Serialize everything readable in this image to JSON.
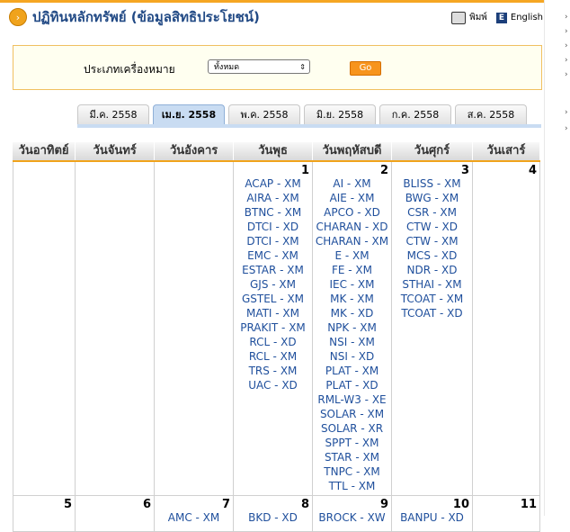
{
  "page": {
    "title": "ปฏิทินหลักทรัพย์ (ข้อมูลสิทธิประโยชน์)",
    "print_label": "พิมพ์",
    "english_label": "English"
  },
  "filter": {
    "label": "ประเภทเครื่องหมาย",
    "selected": "ทั้งหมด",
    "go_label": "Go"
  },
  "tabs": [
    "มี.ค. 2558",
    "เม.ย. 2558",
    "พ.ค. 2558",
    "มิ.ย. 2558",
    "ก.ค. 2558",
    "ส.ค. 2558"
  ],
  "active_tab": 1,
  "weekdays": [
    "วันอาทิตย์",
    "วันจันทร์",
    "วันอังคาร",
    "วันพุธ",
    "วันพฤหัสบดี",
    "วันศุกร์",
    "วันเสาร์"
  ],
  "week1": [
    {
      "day": "",
      "items": []
    },
    {
      "day": "",
      "items": []
    },
    {
      "day": "",
      "items": []
    },
    {
      "day": "1",
      "items": [
        "ACAP - XM",
        "AIRA - XM",
        "BTNC - XM",
        "DTCI - XD",
        "DTCI - XM",
        "EMC - XM",
        "ESTAR - XM",
        "GJS - XM",
        "GSTEL - XM",
        "MATI - XM",
        "PRAKIT - XM",
        "RCL - XD",
        "RCL - XM",
        "TRS - XM",
        "UAC - XD"
      ]
    },
    {
      "day": "2",
      "items": [
        "AI - XM",
        "AIE - XM",
        "APCO - XD",
        "CHARAN - XD",
        "CHARAN - XM",
        "E - XM",
        "FE - XM",
        "IEC - XM",
        "MK - XM",
        "MK - XD",
        "NPK - XM",
        "NSI - XM",
        "NSI - XD",
        "PLAT - XM",
        "PLAT - XD",
        "RML-W3 - XE",
        "SOLAR - XM",
        "SOLAR - XR",
        "SPPT - XM",
        "STAR - XM",
        "TNPC - XM",
        "TTL - XM"
      ]
    },
    {
      "day": "3",
      "items": [
        "BLISS - XM",
        "BWG - XM",
        "CSR - XM",
        "CTW - XD",
        "CTW - XM",
        "MCS - XD",
        "NDR - XD",
        "STHAI - XM",
        "TCOAT - XM",
        "TCOAT - XD"
      ]
    },
    {
      "day": "4",
      "items": []
    }
  ],
  "week2": [
    {
      "day": "5",
      "items": []
    },
    {
      "day": "6",
      "items": []
    },
    {
      "day": "7",
      "items": [
        "AMC - XM"
      ]
    },
    {
      "day": "8",
      "items": [
        "BKD - XD"
      ]
    },
    {
      "day": "9",
      "items": [
        "BROCK - XW"
      ]
    },
    {
      "day": "10",
      "items": [
        "BANPU - XD"
      ]
    },
    {
      "day": "11",
      "items": []
    }
  ]
}
